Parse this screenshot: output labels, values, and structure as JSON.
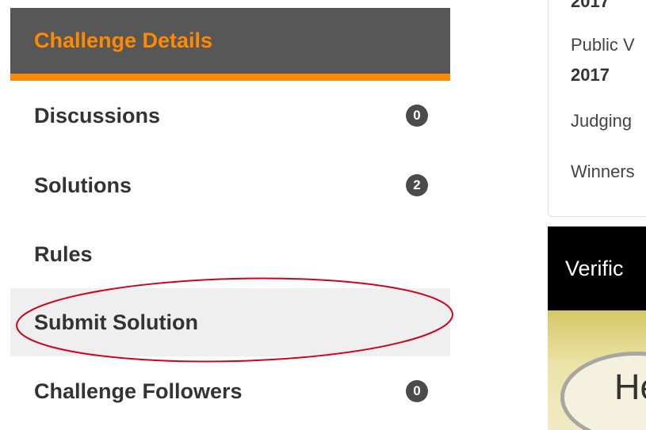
{
  "nav": {
    "header": "Challenge Details",
    "items": [
      {
        "label": "Discussions",
        "badge": "0"
      },
      {
        "label": "Solutions",
        "badge": "2"
      },
      {
        "label": "Rules"
      },
      {
        "label": "Submit Solution"
      },
      {
        "label": "Challenge Followers",
        "badge": "0"
      }
    ]
  },
  "panel": {
    "line_top": "2017",
    "public_voting": "Public V",
    "public_voting_year": "2017",
    "judging": "Judging",
    "winners": "Winners"
  },
  "verify": {
    "title": "Verific",
    "bubble_text": "He"
  },
  "colors": {
    "accent": "#ff8a00",
    "header_bg": "#575757",
    "badge_bg": "#4b4b4b",
    "annotation": "#d0021b"
  }
}
